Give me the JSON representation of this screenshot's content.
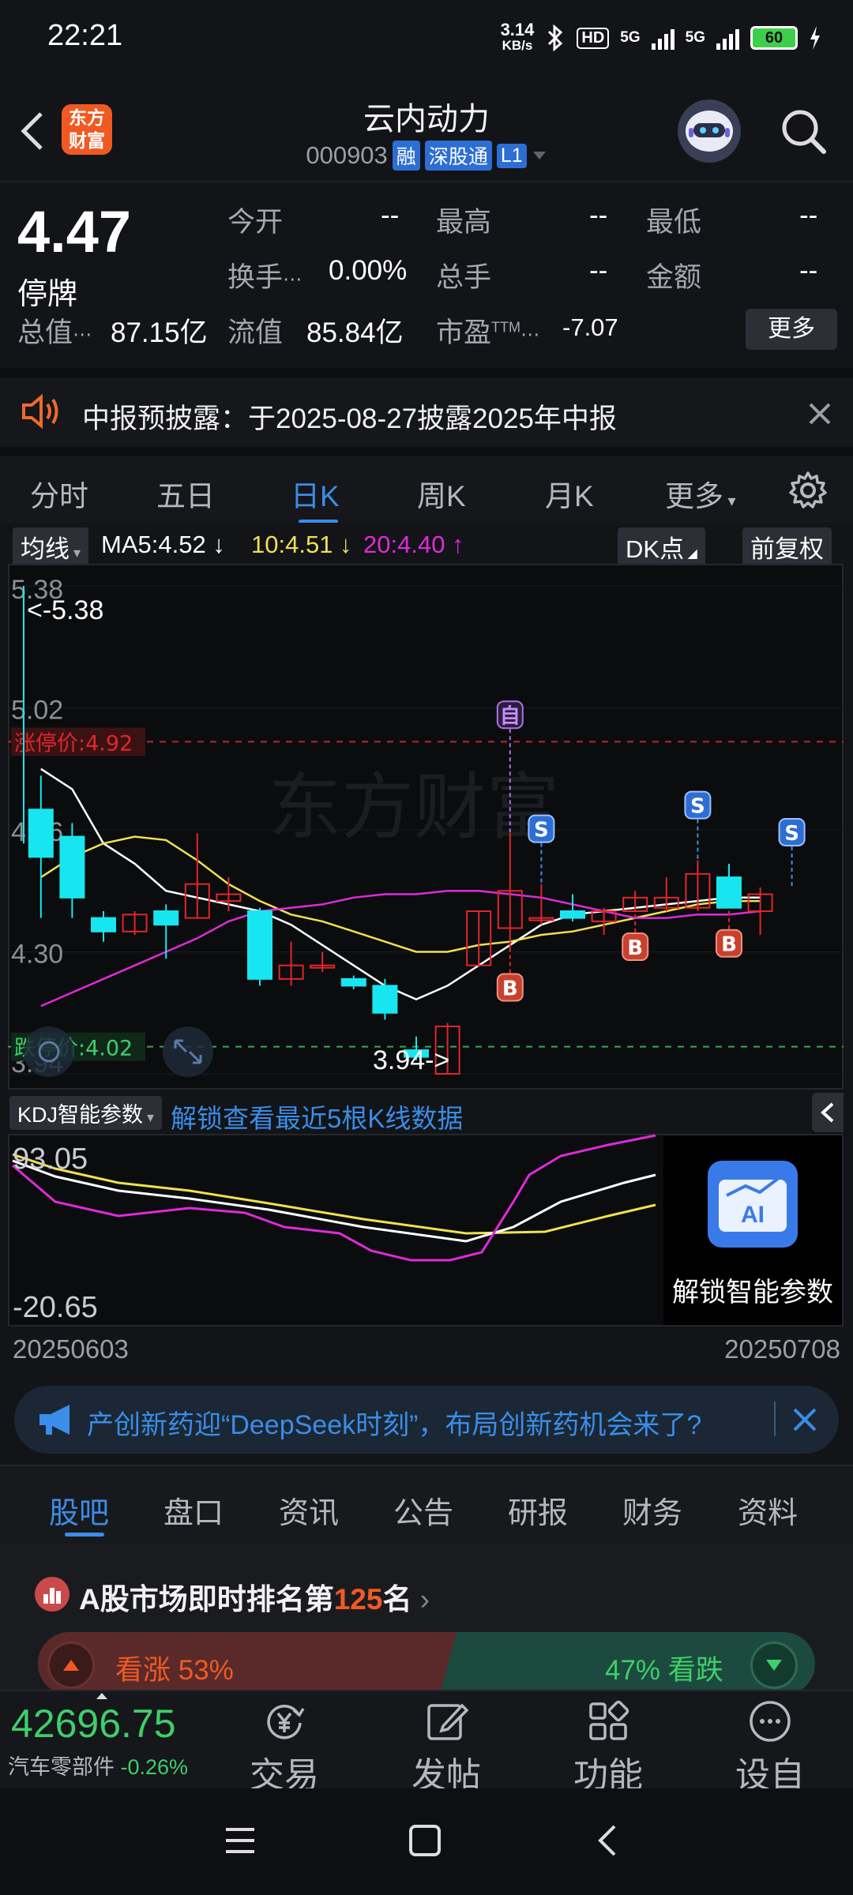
{
  "status_bar": {
    "time": "22:21",
    "net_speed_top": "3.14",
    "net_speed_bottom": "KB/s",
    "hd_label": "HD",
    "sig1_label": "5G",
    "sig2_label": "5G",
    "battery": "60"
  },
  "header": {
    "logo_line1": "东方",
    "logo_line2": "财富",
    "stock_name": "云内动力",
    "stock_code": "000903",
    "tag_rong": "融",
    "tag_sst": "深股通",
    "tag_l1": "L1"
  },
  "quote": {
    "price": "4.47",
    "status": "停牌",
    "open_label": "今开",
    "open_value": "--",
    "high_label": "最高",
    "high_value": "--",
    "low_label": "最低",
    "low_value": "--",
    "turnover_label": "换手",
    "turnover_value": "0.00%",
    "volume_label": "总手",
    "volume_value": "--",
    "amount_label": "金额",
    "amount_value": "--",
    "total_mv_label": "总值",
    "total_mv_value": "87.15亿",
    "float_mv_label": "流值",
    "float_mv_value": "85.84亿",
    "pe_label": "市盈",
    "pe_sup": "TTM",
    "pe_value": "-7.07",
    "more_label": "更多"
  },
  "notice": {
    "text": "中报预披露：于2025-08-27披露2025年中报"
  },
  "chart_tabs": [
    "分时",
    "五日",
    "日K",
    "周K",
    "月K",
    "更多"
  ],
  "chart_tabs_active": "日K",
  "ma_row": {
    "selector": "均线",
    "ma5": "MA5:4.52",
    "ma10": "10:4.51",
    "ma20": "20:4.40",
    "dk_label": "DK点",
    "adjust_label": "前复权"
  },
  "chart_data": {
    "type": "candlestick",
    "price_axis_labels": [
      "5.38",
      "5.02",
      "4.66",
      "4.30",
      "3.94"
    ],
    "ylim": [
      3.94,
      5.38
    ],
    "limit_up_label": "涨停价:4.92",
    "limit_up_value": 4.92,
    "limit_down_label": "跌停价:4.02",
    "limit_down_value": 4.02,
    "max_label": "<-5.38",
    "max_value": 5.38,
    "min_label": "3.94->",
    "min_value": 3.94,
    "candles": [
      {
        "o": 4.72,
        "c": 4.58,
        "h": 4.82,
        "l": 4.4
      },
      {
        "o": 4.64,
        "c": 4.46,
        "h": 4.68,
        "l": 4.4
      },
      {
        "o": 4.4,
        "c": 4.36,
        "h": 4.42,
        "l": 4.33
      },
      {
        "o": 4.36,
        "c": 4.41,
        "h": 4.42,
        "l": 4.35
      },
      {
        "o": 4.42,
        "c": 4.38,
        "h": 4.44,
        "l": 4.28
      },
      {
        "o": 4.4,
        "c": 4.5,
        "h": 4.65,
        "l": 4.4
      },
      {
        "o": 4.45,
        "c": 4.47,
        "h": 4.52,
        "l": 4.42
      },
      {
        "o": 4.42,
        "c": 4.22,
        "h": 4.43,
        "l": 4.2
      },
      {
        "o": 4.22,
        "c": 4.26,
        "h": 4.33,
        "l": 4.2
      },
      {
        "o": 4.26,
        "c": 4.26,
        "h": 4.3,
        "l": 4.24
      },
      {
        "o": 4.22,
        "c": 4.2,
        "h": 4.23,
        "l": 4.19
      },
      {
        "o": 4.2,
        "c": 4.12,
        "h": 4.22,
        "l": 4.1
      },
      {
        "o": 4.01,
        "c": 3.99,
        "h": 4.05,
        "l": 3.98
      },
      {
        "o": 3.94,
        "c": 4.08,
        "h": 4.09,
        "l": 3.94
      },
      {
        "o": 4.26,
        "c": 4.42,
        "h": 4.42,
        "l": 4.26
      },
      {
        "o": 4.37,
        "c": 4.48,
        "h": 4.65,
        "l": 4.3
      },
      {
        "o": 4.4,
        "c": 4.4,
        "h": 4.5,
        "l": 4.38
      },
      {
        "o": 4.42,
        "c": 4.4,
        "h": 4.47,
        "l": 4.39
      },
      {
        "o": 4.39,
        "c": 4.42,
        "h": 4.43,
        "l": 4.35
      },
      {
        "o": 4.42,
        "c": 4.46,
        "h": 4.48,
        "l": 4.42
      },
      {
        "o": 4.43,
        "c": 4.46,
        "h": 4.52,
        "l": 4.42
      },
      {
        "o": 4.43,
        "c": 4.53,
        "h": 4.57,
        "l": 4.42
      },
      {
        "o": 4.52,
        "c": 4.43,
        "h": 4.56,
        "l": 4.43
      },
      {
        "o": 4.42,
        "c": 4.47,
        "h": 4.49,
        "l": 4.35
      }
    ],
    "ma5": [
      4.84,
      4.78,
      4.62,
      4.56,
      4.48,
      4.46,
      4.44,
      4.42,
      4.38,
      4.32,
      4.26,
      4.2,
      4.16,
      4.2,
      4.26,
      4.32,
      4.38,
      4.41,
      4.42,
      4.43,
      4.44,
      4.45,
      4.46,
      4.46
    ],
    "ma10": [
      4.52,
      4.58,
      4.62,
      4.64,
      4.63,
      4.57,
      4.5,
      4.45,
      4.41,
      4.39,
      4.36,
      4.33,
      4.3,
      4.3,
      4.32,
      4.33,
      4.35,
      4.36,
      4.38,
      4.4,
      4.42,
      4.44,
      4.45,
      4.45
    ],
    "ma20": [
      4.14,
      4.18,
      4.22,
      4.26,
      4.3,
      4.34,
      4.39,
      4.42,
      4.43,
      4.44,
      4.46,
      4.47,
      4.47,
      4.48,
      4.48,
      4.47,
      4.46,
      4.44,
      4.42,
      4.4,
      4.4,
      4.41,
      4.41,
      4.42
    ],
    "markers": [
      {
        "label": "自",
        "index": 15,
        "kind": "self"
      },
      {
        "label": "S",
        "index": 16,
        "kind": "sell"
      },
      {
        "label": "S",
        "index": 21,
        "kind": "sell"
      },
      {
        "label": "S",
        "index": 24,
        "kind": "sell"
      },
      {
        "label": "B",
        "index": 15,
        "kind": "buy"
      },
      {
        "label": "B",
        "index": 19,
        "kind": "buy"
      },
      {
        "label": "B",
        "index": 22,
        "kind": "buy"
      }
    ]
  },
  "kdj": {
    "selector": "KDJ智能参数",
    "unlock_text": "解锁查看最近5根K线数据",
    "max_label": "93.05",
    "min_label": "-20.65",
    "unlock_panel_text": "解锁智能参数",
    "ai_label": "AI"
  },
  "dates": {
    "start": "20250603",
    "end": "20250708"
  },
  "ad": {
    "text": "产创新药迎“DeepSeek时刻”，布局创新药机会来了?"
  },
  "info_tabs": [
    "股吧",
    "盘口",
    "资讯",
    "公告",
    "研报",
    "财务",
    "资料"
  ],
  "info_tabs_active": "股吧",
  "ranking": {
    "prefix": "A股市场即时排名第",
    "rank": "125",
    "suffix": "名",
    "bull_label": "看涨 53%",
    "bear_label": "47% 看跌"
  },
  "bottom_bar": {
    "index_value": "42696.75",
    "index_name": "汽车零部件",
    "index_change": "-0.26%",
    "items": [
      "交易",
      "发帖",
      "功能",
      "设自选"
    ]
  },
  "colors": {
    "up": "#e0262b",
    "down": "#17e6f0",
    "ma5": "#ffffff",
    "ma10": "#f0e050",
    "ma20": "#e02ad8",
    "accent": "#3a8de8"
  }
}
